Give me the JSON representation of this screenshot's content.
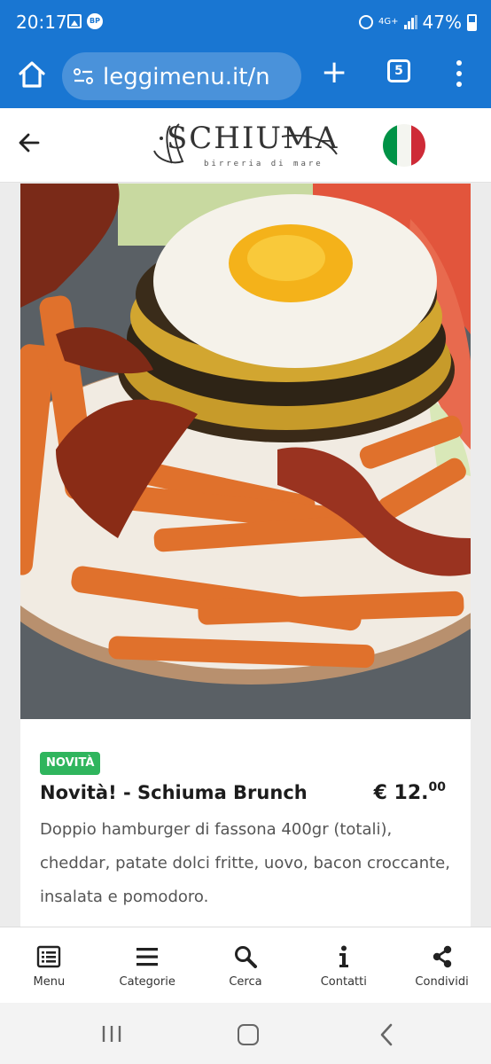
{
  "status_bar": {
    "time": "20:17",
    "bp_badge": "BP",
    "network": "4G+",
    "battery": "47%"
  },
  "browser": {
    "url": "leggimenu.it/n",
    "tab_count": "5"
  },
  "site_header": {
    "logo_text": "SCHIUMA",
    "logo_subtitle": "birreria di mare",
    "language_flag": "flag-italy-icon"
  },
  "dish": {
    "badge": "NOVITÀ",
    "title": "Novità! - Schiuma Brunch",
    "price_main": "€ 12.",
    "price_cents": "00",
    "description": "Doppio hamburger di fassona 400gr (totali), cheddar, patate dolci fritte, uovo, bacon croccante, insalata e pomodoro."
  },
  "bottom_nav": {
    "items": [
      {
        "label": "Menu",
        "icon": "menu-list-icon"
      },
      {
        "label": "Categorie",
        "icon": "categories-icon"
      },
      {
        "label": "Cerca",
        "icon": "search-icon"
      },
      {
        "label": "Contatti",
        "icon": "info-icon"
      },
      {
        "label": "Condividi",
        "icon": "share-icon"
      }
    ]
  },
  "colors": {
    "browser_blue": "#1976d2",
    "badge_green": "#2fb55d",
    "flag_green": "#009246",
    "flag_red": "#ce2b37"
  }
}
